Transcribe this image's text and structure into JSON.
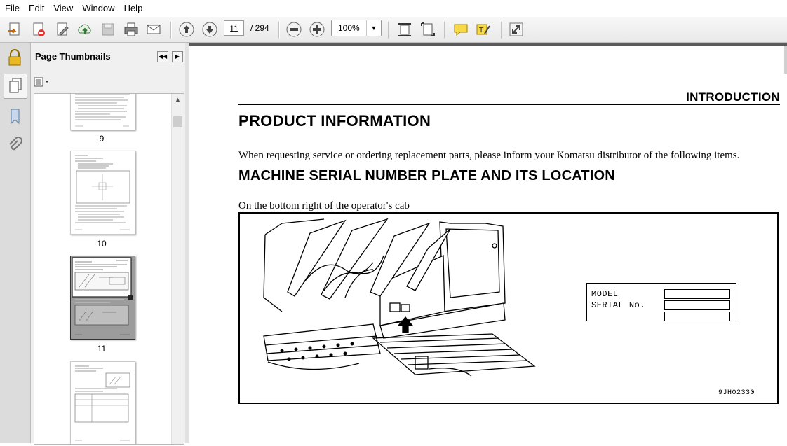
{
  "menu": [
    "File",
    "Edit",
    "View",
    "Window",
    "Help"
  ],
  "toolbar": {
    "current_page": "11",
    "total_pages": "/ 294",
    "zoom": "100%",
    "icons": [
      "create-icon",
      "export-icon",
      "edit-icon",
      "upload-icon",
      "save-icon",
      "print-icon",
      "email-icon",
      "prev-page-icon",
      "next-page-icon",
      "zoom-out-icon",
      "zoom-in-icon",
      "fit-width-icon",
      "fit-page-icon",
      "comment-icon",
      "highlight-icon",
      "fullscreen-icon"
    ]
  },
  "panel": {
    "title": "Page Thumbnails",
    "thumbnails": [
      {
        "label": "9"
      },
      {
        "label": "10"
      },
      {
        "label": "11"
      },
      {
        "label": ""
      }
    ]
  },
  "document": {
    "header": "INTRODUCTION",
    "title": "PRODUCT INFORMATION",
    "paragraph": "When requesting service or ordering replacement parts, please inform your Komatsu distributor of the following items.",
    "subtitle": "MACHINE SERIAL NUMBER PLATE AND ITS LOCATION",
    "location_text": "On the bottom right of the operator's cab",
    "figure": {
      "plate_model_label": "MODEL",
      "plate_serial_label": "SERIAL No.",
      "figure_id": "9JH02330"
    }
  }
}
